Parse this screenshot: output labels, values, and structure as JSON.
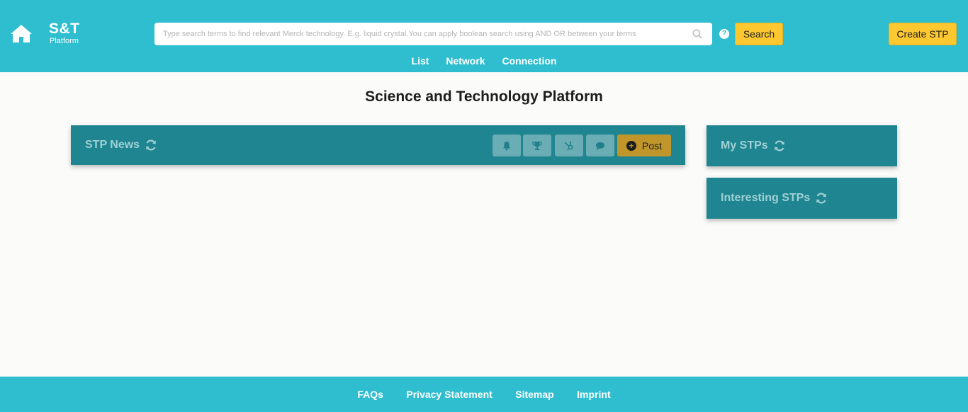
{
  "header": {
    "brand_title": "S&T",
    "brand_subtitle": "Platform",
    "search_placeholder": "Type search terms to find relevant Merck technology. E.g. liquid crystal.You can apply boolean search using AND OR between your terms",
    "help_glyph": "?",
    "search_button": "Search",
    "create_button": "Create STP"
  },
  "nav": {
    "items": [
      {
        "label": "List"
      },
      {
        "label": "Network"
      },
      {
        "label": "Connection"
      }
    ]
  },
  "main": {
    "title": "Science and Technology Platform",
    "news_panel": {
      "title": "STP News",
      "tools": [
        "bell-icon",
        "trophy-icon",
        "hubspot-icon",
        "comment-icon"
      ],
      "post_button": "Post"
    },
    "side_panels": [
      {
        "title": "My STPs"
      },
      {
        "title": "Interesting STPs"
      }
    ]
  },
  "footer": {
    "links": [
      {
        "label": "FAQs"
      },
      {
        "label": "Privacy Statement"
      },
      {
        "label": "Sitemap"
      },
      {
        "label": "Imprint"
      }
    ]
  },
  "colors": {
    "header_bg": "#2fbecf",
    "panel_bg": "#1f8590",
    "accent_yellow": "#fcc72f",
    "post_button": "#c0962a",
    "page_bg": "#fbfbf9"
  }
}
